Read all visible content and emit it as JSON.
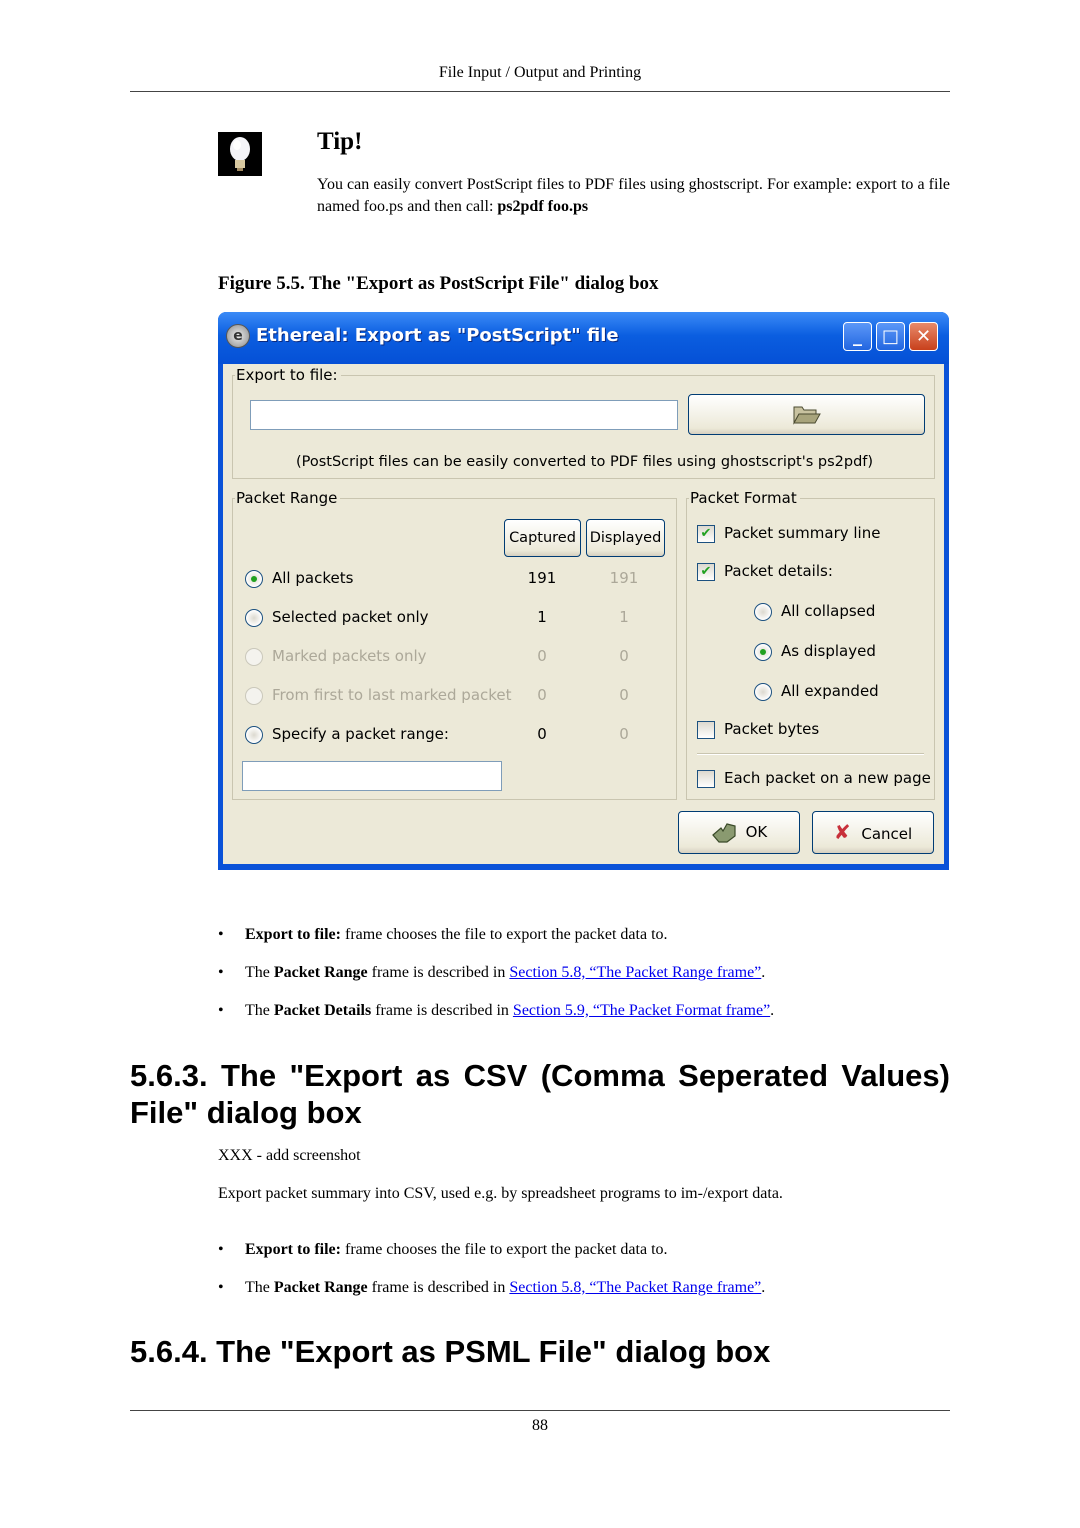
{
  "header": {
    "running_title": "File Input / Output and Printing"
  },
  "tip": {
    "icon": "lightbulb-icon",
    "title": "Tip!",
    "text": "You can easily convert PostScript files to PDF files using ghostscript. For example: export to a file named foo.ps and then call: ",
    "command": "ps2pdf foo.ps"
  },
  "figure": {
    "caption": "Figure 5.5. The \"Export as PostScript File\" dialog box"
  },
  "dialog": {
    "title": "Ethereal: Export as \"PostScript\" file",
    "app_icon": "ethereal-icon",
    "controls": {
      "minimize": "_",
      "maximize": "□",
      "close": "✕"
    },
    "export_frame": {
      "legend": "Export to file:",
      "file_value": "",
      "browse_icon": "folder-open-icon",
      "hint": "(PostScript files can be easily converted to PDF files using ghostscript's ps2pdf)"
    },
    "packet_range": {
      "legend": "Packet Range",
      "captured_label": "Captured",
      "displayed_label": "Displayed",
      "rows": [
        {
          "label": "All packets",
          "captured": "191",
          "displayed": "191",
          "selected": true,
          "enabled": true
        },
        {
          "label": "Selected packet only",
          "captured": "1",
          "displayed": "1",
          "selected": false,
          "enabled": true
        },
        {
          "label": "Marked packets only",
          "captured": "0",
          "displayed": "0",
          "selected": false,
          "enabled": false
        },
        {
          "label": "From first to last marked packet",
          "captured": "0",
          "displayed": "0",
          "selected": false,
          "enabled": false
        },
        {
          "label": "Specify a packet range:",
          "captured": "0",
          "displayed": "0",
          "selected": false,
          "enabled": true
        }
      ],
      "range_value": ""
    },
    "packet_format": {
      "legend": "Packet Format",
      "summary_line": {
        "label": "Packet summary line",
        "checked": true
      },
      "details": {
        "label": "Packet details:",
        "checked": true
      },
      "detail_options": [
        {
          "label": "All collapsed",
          "selected": false
        },
        {
          "label": "As displayed",
          "selected": true
        },
        {
          "label": "All expanded",
          "selected": false
        }
      ],
      "bytes": {
        "label": "Packet bytes",
        "checked": false
      },
      "new_page": {
        "label": "Each packet on a new page",
        "checked": false
      }
    },
    "ok_label": "OK",
    "cancel_label": "Cancel"
  },
  "bullets_1": [
    {
      "bold": "Export to file:",
      "pre": "",
      "text": " frame chooses the file to export the packet data to.",
      "link": "",
      "post": ""
    },
    {
      "pre": "The ",
      "bold": "Packet Range",
      "text": " frame is described in ",
      "link": "Section 5.8, “The Packet Range frame”",
      "post": "."
    },
    {
      "pre": "The ",
      "bold": "Packet Details",
      "text": " frame is described in ",
      "link": "Section 5.9, “The Packet Format frame”",
      "post": "."
    }
  ],
  "section_563": {
    "heading": "5.6.3. The \"Export as CSV (Comma Seperated Values) File\" dialog box",
    "para1": "XXX - add screenshot",
    "para2": "Export packet summary into CSV, used e.g. by spreadsheet programs to im-/export data."
  },
  "bullets_2": [
    {
      "pre": "",
      "bold": "Export to file:",
      "text": " frame chooses the file to export the packet data to.",
      "link": "",
      "post": ""
    },
    {
      "pre": "The ",
      "bold": "Packet Range",
      "text": " frame is described in ",
      "link": "Section 5.8, “The Packet Range frame”",
      "post": "."
    }
  ],
  "section_564": {
    "heading": "5.6.4. The \"Export as PSML File\" dialog box"
  },
  "footer": {
    "page_number": "88"
  }
}
